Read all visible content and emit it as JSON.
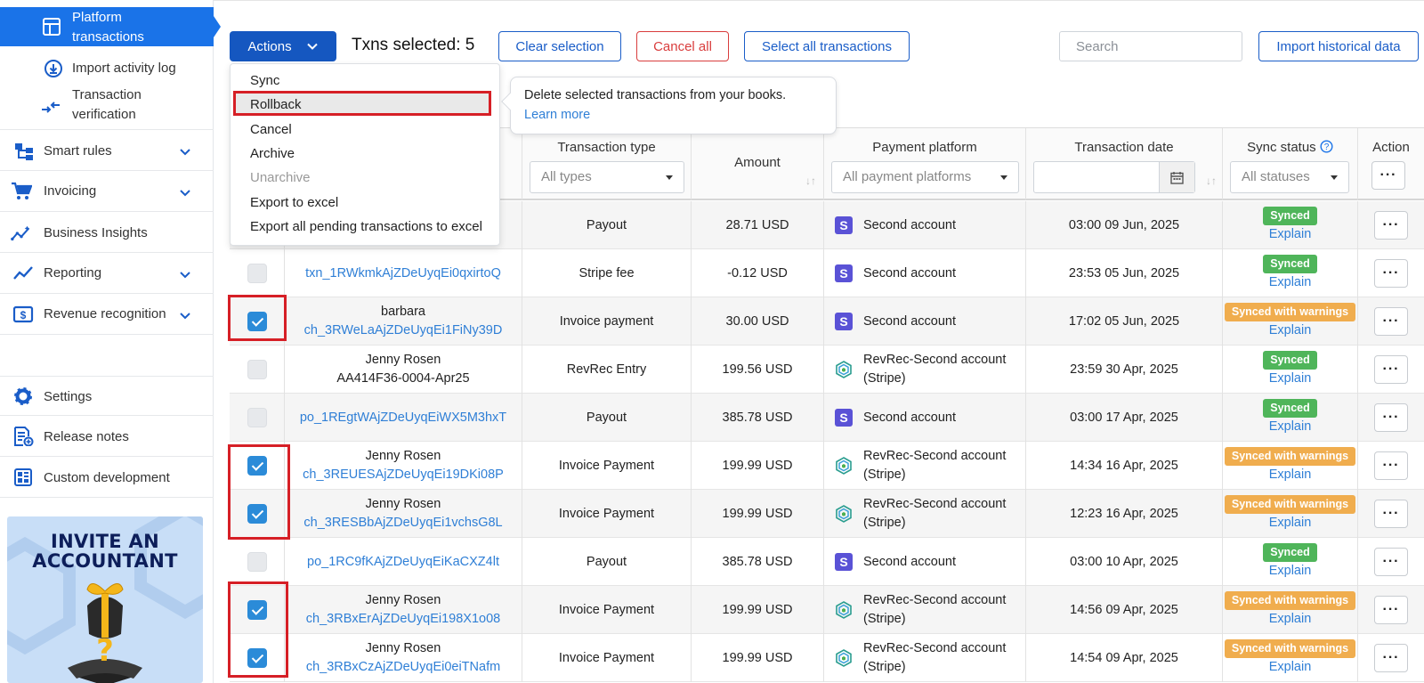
{
  "sidebar": {
    "active": {
      "line1": "Platform",
      "line2": "transactions"
    },
    "import_log": "Import activity log",
    "verification": {
      "line1": "Transaction",
      "line2": "verification"
    },
    "smart_rules": "Smart rules",
    "invoicing": "Invoicing",
    "insights": "Business Insights",
    "reporting": "Reporting",
    "revenue": "Revenue recognition",
    "settings": "Settings",
    "release": "Release notes",
    "custom": "Custom development",
    "invite": {
      "line1": "INVITE AN",
      "line2": "ACCOUNTANT"
    }
  },
  "toolbar": {
    "actions": "Actions",
    "txns_selected": "Txns selected: 5",
    "clear": "Clear selection",
    "cancel_all": "Cancel all",
    "select_all": "Select all transactions",
    "search_placeholder": "Search",
    "import_historical": "Import historical data"
  },
  "menu": {
    "sync": "Sync",
    "rollback": "Rollback",
    "cancel": "Cancel",
    "archive": "Archive",
    "unarchive": "Unarchive",
    "export": "Export to excel",
    "export_pending": "Export all pending transactions to excel"
  },
  "tooltip": {
    "text": "Delete selected transactions from your books.",
    "link": "Learn more"
  },
  "headers": {
    "type": "Transaction type",
    "type_placeholder": "All types",
    "amount": "Amount",
    "platform": "Payment platform",
    "platform_placeholder": "All payment platforms",
    "date": "Transaction date",
    "status": "Sync status",
    "status_placeholder": "All statuses",
    "action": "Action"
  },
  "rows": [
    {
      "name": "",
      "id": "",
      "type": "Payout",
      "amount": "28.71 USD",
      "platform": "Second account",
      "platform2": "",
      "logo": "stripe",
      "date": "03:00 09 Jun, 2025",
      "status": "Synced",
      "explain": "Explain",
      "checked": null
    },
    {
      "name": "",
      "id": "txn_1RWkmkAjZDeUyqEi0qxirtoQ",
      "type": "Stripe fee",
      "amount": "-0.12 USD",
      "platform": "Second account",
      "platform2": "",
      "logo": "stripe",
      "date": "23:53 05 Jun, 2025",
      "status": "Synced",
      "explain": "Explain",
      "checked": false
    },
    {
      "name": "barbara",
      "id": "ch_3RWeLaAjZDeUyqEi1FiNy39D",
      "type": "Invoice payment",
      "amount": "30.00 USD",
      "platform": "Second account",
      "platform2": "",
      "logo": "stripe",
      "date": "17:02 05 Jun, 2025",
      "status": "Synced with warnings",
      "explain": "Explain",
      "checked": true
    },
    {
      "name": "Jenny Rosen",
      "id": "AA414F36-0004-Apr25",
      "idPlain": true,
      "type": "RevRec Entry",
      "amount": "199.56 USD",
      "platform": "RevRec-Second account",
      "platform2": "(Stripe)",
      "logo": "revrec",
      "date": "23:59 30 Apr, 2025",
      "status": "Synced",
      "explain": "Explain",
      "checked": false
    },
    {
      "name": "",
      "id": "po_1REgtWAjZDeUyqEiWX5M3hxT",
      "type": "Payout",
      "amount": "385.78 USD",
      "platform": "Second account",
      "platform2": "",
      "logo": "stripe",
      "date": "03:00 17 Apr, 2025",
      "status": "Synced",
      "explain": "Explain",
      "checked": false
    },
    {
      "name": "Jenny Rosen",
      "id": "ch_3REUESAjZDeUyqEi19DKi08P",
      "type": "Invoice Payment",
      "amount": "199.99 USD",
      "platform": "RevRec-Second account",
      "platform2": "(Stripe)",
      "logo": "revrec",
      "date": "14:34 16 Apr, 2025",
      "status": "Synced with warnings",
      "explain": "Explain",
      "checked": true
    },
    {
      "name": "Jenny Rosen",
      "id": "ch_3RESBbAjZDeUyqEi1vchsG8L",
      "type": "Invoice Payment",
      "amount": "199.99 USD",
      "platform": "RevRec-Second account",
      "platform2": "(Stripe)",
      "logo": "revrec",
      "date": "12:23 16 Apr, 2025",
      "status": "Synced with warnings",
      "explain": "Explain",
      "checked": true
    },
    {
      "name": "",
      "id": "po_1RC9fKAjZDeUyqEiKaCXZ4lt",
      "type": "Payout",
      "amount": "385.78 USD",
      "platform": "Second account",
      "platform2": "",
      "logo": "stripe",
      "date": "03:00 10 Apr, 2025",
      "status": "Synced",
      "explain": "Explain",
      "checked": false
    },
    {
      "name": "Jenny Rosen",
      "id": "ch_3RBxErAjZDeUyqEi198X1o08",
      "type": "Invoice Payment",
      "amount": "199.99 USD",
      "platform": "RevRec-Second account",
      "platform2": "(Stripe)",
      "logo": "revrec",
      "date": "14:56 09 Apr, 2025",
      "status": "Synced with warnings",
      "explain": "Explain",
      "checked": true
    },
    {
      "name": "Jenny Rosen",
      "id": "ch_3RBxCzAjZDeUyqEi0eiTNafm",
      "type": "Invoice Payment",
      "amount": "199.99 USD",
      "platform": "RevRec-Second account",
      "platform2": "(Stripe)",
      "logo": "revrec",
      "date": "14:54 09 Apr, 2025",
      "status": "Synced with warnings",
      "explain": "Explain",
      "checked": true
    }
  ],
  "colors": {
    "primary": "#1557c0",
    "active": "#1a73e8",
    "link": "#2f7fd6",
    "synced": "#4fb55a",
    "warn": "#f0ad4e",
    "highlight": "#d61f26"
  }
}
